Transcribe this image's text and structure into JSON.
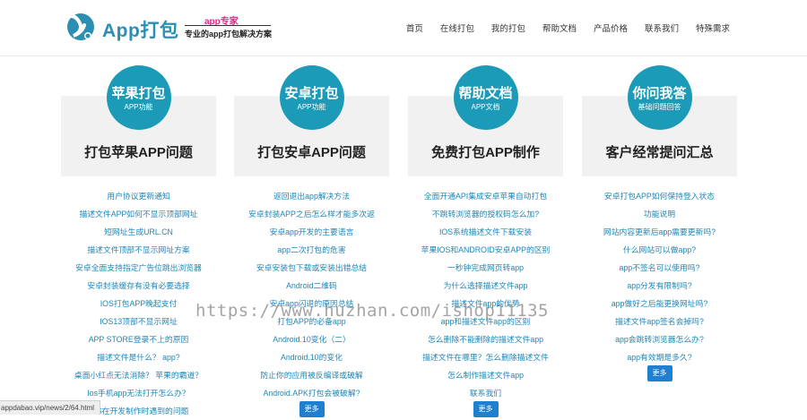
{
  "header": {
    "brand": "App打包",
    "tagline_top": "app专家",
    "tagline_bottom": "专业的app打包解决方案",
    "nav": [
      "首页",
      "在线打包",
      "我的打包",
      "帮助文档",
      "产品价格",
      "联系我们",
      "特殊需求"
    ]
  },
  "colors": {
    "accent": "#1b9bb8",
    "link": "#1f86b8",
    "button": "#1f7fd1"
  },
  "cards": [
    {
      "badge_title": "苹果打包",
      "badge_sub": "APP功能",
      "title": "打包苹果APP问题",
      "items": [
        "用户协议更新通知",
        "描述文件APP如何不显示顶部网址",
        "短网址生成URL.CN",
        "描述文件顶部不显示网址方案",
        "安卓全面支持指定广告位跳出浏览器",
        "安卓封装缓存有没有必要选择",
        "IOS打包APP晚起支付",
        "IOS13顶部不显示网址",
        "APP STORE登录不上的原因",
        "描述文件是什么？ app?",
        "桌面小红点无法消除？ 苹果的霸道？",
        "Ios手机app无法打开怎么办？",
        "IOS在开发制作时遇到的问题"
      ],
      "more": ""
    },
    {
      "badge_title": "安卓打包",
      "badge_sub": "APP功能",
      "title": "打包安卓APP问题",
      "items": [
        "返回退出app解决方法",
        "安卓封装APP之后怎么样才能多次返",
        "安卓app开发的主要语言",
        "app二次打包的危害",
        "安卓安装包下载或安装出错总结",
        "Android二维码",
        "安卓app闪退的原因总结",
        "打包APP的必备app",
        "Android.10变化（二）",
        "Android.10的变化",
        "防止你的应用被反编译或破解",
        "Android.APK打包会被破解?"
      ],
      "more": "更多"
    },
    {
      "badge_title": "帮助文档",
      "badge_sub": "APP文档",
      "title": "免费打包APP制作",
      "items": [
        "全面开通API集成安卓苹果自动打包",
        "不跳转浏览器的授权码怎么加?",
        "IOS系统描述文件下载安装",
        "苹果IOS和ANDROID安卓APP的区别",
        "一秒钟完成网页转app",
        "为什么选择描述文件app",
        "描述文件app的优势",
        "app和描述文件app的区别",
        "怎么删除不能删除的描述文件app",
        "描述文件在哪里？怎么删除描述文件",
        "怎么制作描述文件app",
        "联系我们"
      ],
      "more": "更多"
    },
    {
      "badge_title": "你问我答",
      "badge_sub": "基础问题回答",
      "title": "客户经常提问汇总",
      "items": [
        "安卓打包APP如何保持登入状态",
        "功能说明",
        "网站内容更新后app需要更新吗?",
        "什么网站可以做app?",
        "app不签名可以使用吗?",
        "app分发有限制吗?",
        "app做好之后能更换网址吗?",
        "描述文件app签名会掉吗?",
        "app会跳转浏览器怎么办?",
        "app有效期是多久?"
      ],
      "more": "更多"
    }
  ],
  "watermark": "https://www.huzhan.com/ishop11135",
  "status_url": "appdabao.vip/news/2/64.html"
}
